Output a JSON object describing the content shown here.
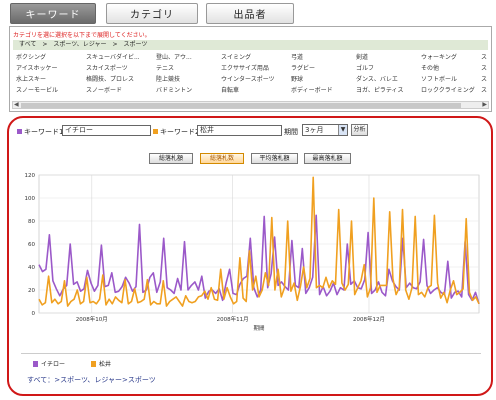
{
  "tabs": [
    {
      "label": "キーワード",
      "active": true
    },
    {
      "label": "カテゴリ",
      "active": false
    },
    {
      "label": "出品者",
      "active": false
    }
  ],
  "category_panel": {
    "note": "カテゴリを選に選択を以下まで展開してください。",
    "breadcrumb": "すべて　>　スポーツ、レジャー　>　スポーツ",
    "rows": [
      [
        "ボクシング",
        "スキューバダイビ...",
        "登山、アウ...",
        "スイミング",
        "弓道",
        "剣道",
        "ウォーキング",
        "ス"
      ],
      [
        "アイスホッケー",
        "スカイスポーツ",
        "テニス",
        "エクササイズ用品",
        "ラグビー",
        "ゴルフ",
        "その他",
        "ス"
      ],
      [
        "水上スキー",
        "格闘技、プロレス",
        "陸上競技",
        "ウインタースポーツ",
        "野球",
        "ダンス、バレエ",
        "ソフトボール",
        "ス"
      ],
      [
        "スノーモービル",
        "スノーボード",
        "バドミントン",
        "自転車",
        "ボディーボード",
        "ヨガ、ピラティス",
        "ロッククライミング",
        "ス"
      ]
    ]
  },
  "controls": {
    "kw1_label": "キーワード1",
    "kw1_value": "イチロー",
    "kw2_label": "キーワード2",
    "kw2_value": "松井",
    "period_label": "期間",
    "period_value": "3ヶ月",
    "analyze_label": "分析",
    "kw1_color": "#9b59c9",
    "kw2_color": "#f0a020"
  },
  "metrics": [
    {
      "label": "総落札額",
      "active": false
    },
    {
      "label": "総落札数",
      "active": true
    },
    {
      "label": "平均落札額",
      "active": false
    },
    {
      "label": "最高落札額",
      "active": false
    }
  ],
  "chart_data": {
    "type": "line",
    "xlabel": "期間",
    "ylim": [
      0,
      120
    ],
    "yticks": [
      "0",
      "20",
      "40",
      "60",
      "80",
      "100",
      "120"
    ],
    "xtick_labels": [
      "2008年10月",
      "2008年11月",
      "2008年12月"
    ],
    "grid": true,
    "series": [
      {
        "name": "イチロー",
        "color": "#9b59c9",
        "values": [
          42,
          36,
          38,
          68,
          28,
          21,
          15,
          21,
          24,
          60,
          25,
          27,
          19,
          21,
          37,
          26,
          19,
          24,
          59,
          23,
          24,
          35,
          18,
          19,
          23,
          31,
          26,
          19,
          23,
          77,
          18,
          20,
          31,
          35,
          18,
          27,
          65,
          22,
          20,
          17,
          30,
          20,
          62,
          20,
          24,
          27,
          20,
          32,
          13,
          19,
          20,
          17,
          21,
          11,
          26,
          38,
          17,
          16,
          25,
          30,
          32,
          65,
          22,
          14,
          20,
          84,
          22,
          34,
          66,
          24,
          27,
          23,
          20,
          63,
          24,
          22,
          56,
          17,
          22,
          31,
          85,
          16,
          23,
          15,
          19,
          26,
          16,
          22,
          20,
          60,
          25,
          28,
          22,
          21,
          29,
          70,
          17,
          20,
          27,
          18,
          15,
          38,
          28,
          23,
          20,
          65,
          22,
          26,
          22,
          21,
          27,
          64,
          24,
          17,
          20,
          22,
          18,
          16,
          45,
          13,
          18,
          19,
          14,
          62,
          16,
          11,
          18,
          8
        ]
      },
      {
        "name": "松井",
        "color": "#f0a020",
        "values": [
          12,
          7,
          9,
          32,
          9,
          12,
          8,
          10,
          28,
          6,
          10,
          12,
          20,
          8,
          10,
          31,
          9,
          10,
          8,
          12,
          33,
          7,
          12,
          8,
          14,
          11,
          9,
          29,
          8,
          10,
          21,
          9,
          10,
          12,
          29,
          7,
          10,
          8,
          8,
          28,
          6,
          10,
          12,
          14,
          10,
          6,
          15,
          10,
          9,
          10,
          14,
          15,
          19,
          12,
          22,
          12,
          11,
          38,
          12,
          22,
          14,
          8,
          10,
          48,
          13,
          10,
          54,
          20,
          32,
          14,
          20,
          35,
          24,
          83,
          20,
          38,
          14,
          22,
          80,
          19,
          26,
          11,
          23,
          40,
          22,
          30,
          118,
          22,
          24,
          22,
          31,
          22,
          28,
          25,
          90,
          26,
          20,
          25,
          80,
          16,
          22,
          28,
          42,
          14,
          22,
          100,
          18,
          24,
          24,
          24,
          88,
          30,
          16,
          22,
          90,
          20,
          12,
          22,
          84,
          16,
          18,
          14,
          22,
          24,
          85,
          26,
          13,
          18,
          9,
          20,
          28,
          16,
          18,
          21,
          82,
          18,
          11,
          14,
          8
        ]
      }
    ]
  },
  "legend": {
    "items": [
      {
        "name": "イチロー",
        "color": "#9b59c9"
      },
      {
        "name": "松井",
        "color": "#f0a020"
      }
    ],
    "breadcrumb": "すべて：>スポーツ、レジャー>スポーツ"
  }
}
